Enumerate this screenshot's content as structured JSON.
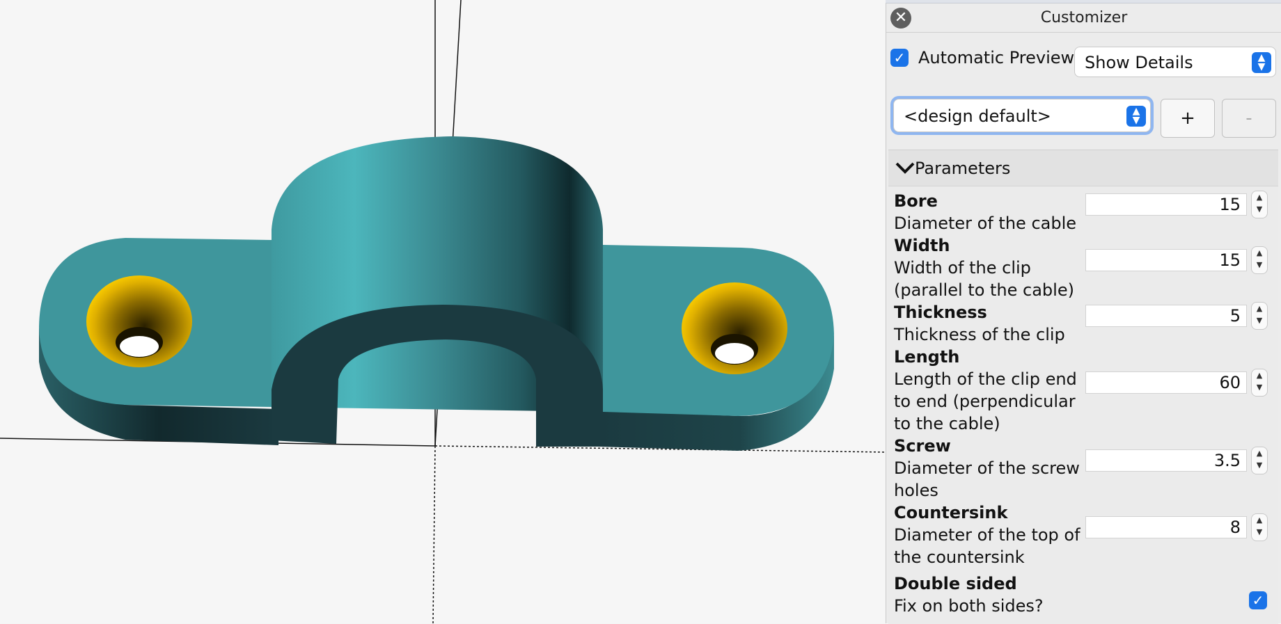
{
  "panel": {
    "close_icon": "close-icon",
    "title": "Customizer",
    "auto_preview": {
      "label": "Automatic Preview",
      "checked": true
    },
    "details_select": {
      "value": "Show Details"
    },
    "preset_select": {
      "value": "<design default>"
    },
    "add_preset_label": "+",
    "remove_preset_label": "-",
    "params_section": {
      "label": "Parameters",
      "items": [
        {
          "name": "Bore",
          "desc": "Diameter of the cable",
          "value": "15"
        },
        {
          "name": "Width",
          "desc": "Width of the clip (parallel to the cable)",
          "value": "15"
        },
        {
          "name": "Thickness",
          "desc": "Thickness of the clip",
          "value": "5"
        },
        {
          "name": "Length",
          "desc": "Length of the clip end to end (perpendicular to the cable)",
          "value": "60"
        },
        {
          "name": "Screw",
          "desc": "Diameter of the screw holes",
          "value": "3.5"
        },
        {
          "name": "Countersink",
          "desc": "Diameter of the top of the countersink",
          "value": "8"
        }
      ],
      "double_sided": {
        "name": "Double sided",
        "desc": "Fix on both sides?",
        "checked": true
      }
    }
  },
  "colors": {
    "accent": "#1a73e8",
    "model_face": "#3f969c",
    "model_dark": "#1b3a40",
    "hole_gold": "#f0c000"
  }
}
